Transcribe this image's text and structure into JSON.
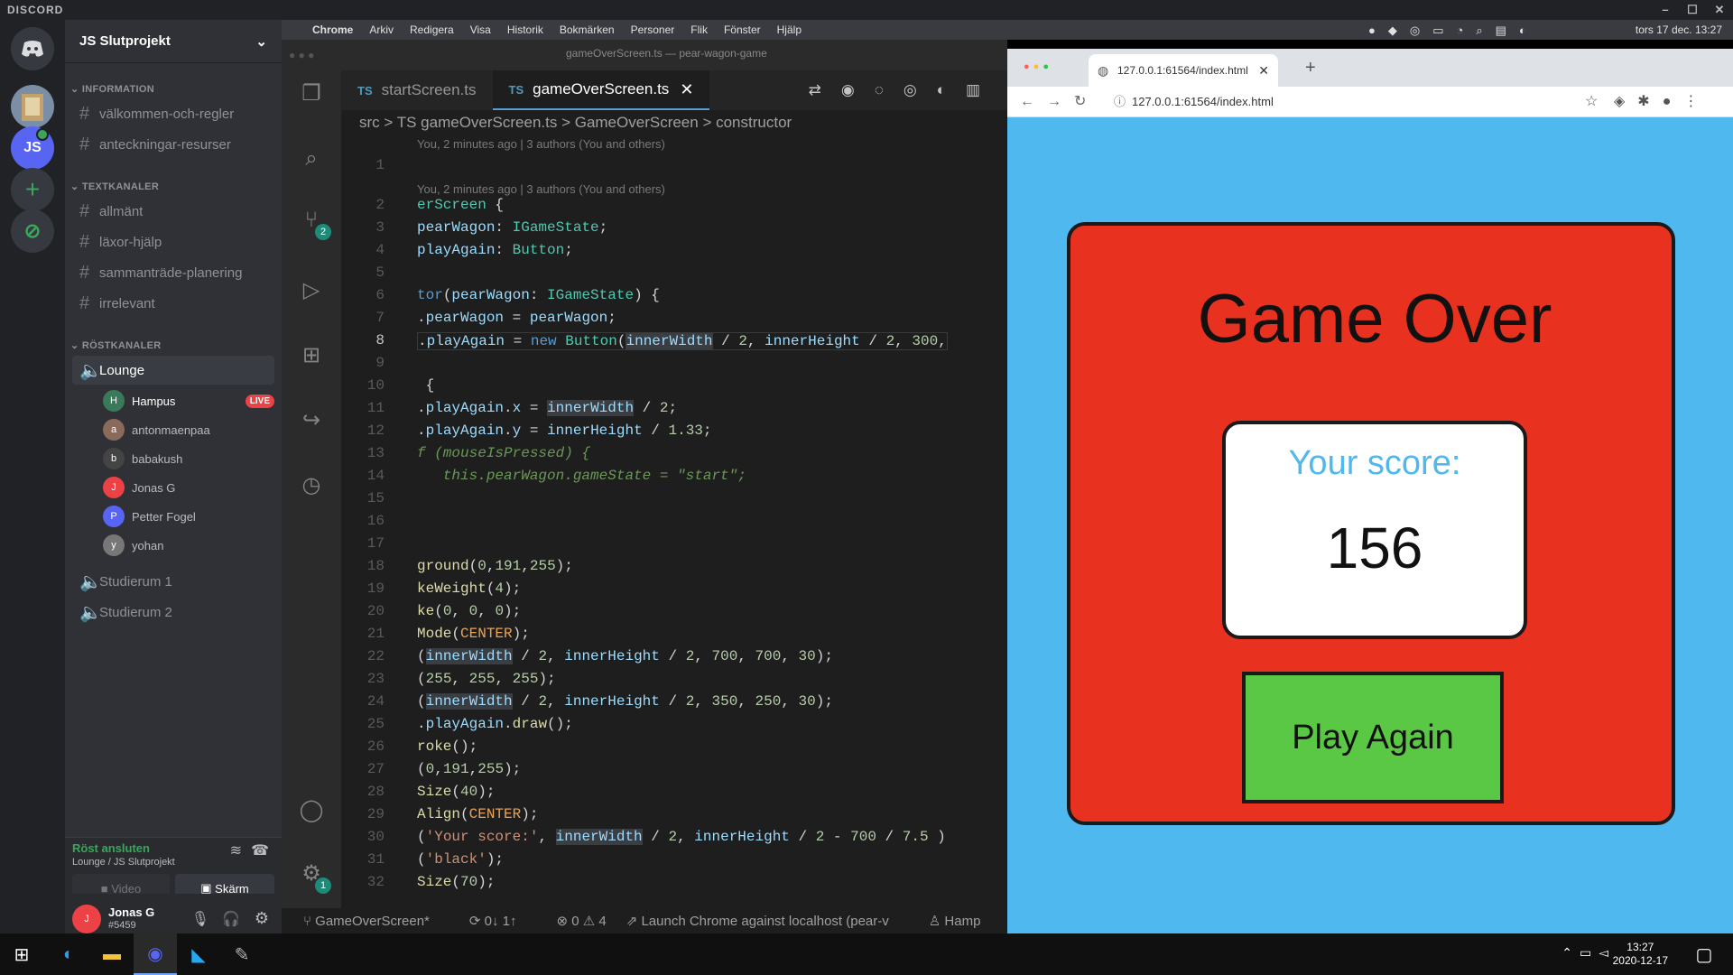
{
  "discord": {
    "window_title": "DISCORD",
    "server_name": "JS Slutprojekt",
    "guild_letters": "JS",
    "categories": [
      "INFORMATION",
      "TEXTKANALER",
      "RÖSTKANALER"
    ],
    "info_channels": [
      "välkommen-och-regler",
      "anteckningar-resurser"
    ],
    "text_channels": [
      "allmänt",
      "läxor-hjälp",
      "sammanträde-planering",
      "irrelevant"
    ],
    "voice_channels": [
      "Lounge",
      "Studierum 1",
      "Studierum 2"
    ],
    "lounge_users": [
      "Hampus",
      "antonmaenpaa",
      "babakush",
      "Jonas G",
      "Petter Fogel",
      "yohan"
    ],
    "live_badge": "LIVE",
    "voice_status": "Röst ansluten",
    "voice_location": "Lounge / JS Slutprojekt",
    "video_label": "Video",
    "screen_label": "Skärm",
    "username": "Jonas G",
    "tag": "#5459"
  },
  "mac_menu": {
    "items": [
      "Chrome",
      "Arkiv",
      "Redigera",
      "Visa",
      "Historik",
      "Bokmärken",
      "Personer",
      "Flik",
      "Fönster",
      "Hjälp"
    ],
    "clock": "tors 17 dec. 13:27",
    "window_title": "gameOverScreen.ts — pear-wagon-game"
  },
  "vscode": {
    "tabs": [
      "startScreen.ts",
      "gameOverScreen.ts"
    ],
    "tab_lang": "TS",
    "breadcrumb": "src > TS gameOverScreen.ts > GameOverScreen > constructor",
    "blame": "You, 2 minutes ago | 3 authors (You and others)",
    "source_control_badge": "2",
    "settings_badge": "1",
    "status_items": [
      "GameOverScreen*",
      "0↓ 1↑",
      "⊗ 0 ⚠ 4",
      "Launch Chrome against localhost (pear-v",
      "Hamp"
    ],
    "line_numbers": [
      "1",
      "2",
      "3",
      "4",
      "5",
      "6",
      "7",
      "8",
      "9",
      "10",
      "11",
      "12",
      "13",
      "14",
      "15",
      "16",
      "17",
      "18",
      "19",
      "20",
      "21",
      "22",
      "23",
      "24",
      "25",
      "26",
      "27",
      "28",
      "29",
      "30",
      "31",
      "32"
    ]
  },
  "chrome": {
    "tab_title": "127.0.0.1:61564/index.html",
    "url": "127.0.0.1:61564/index.html"
  },
  "game": {
    "title": "Game Over",
    "score_label": "Your score:",
    "score": "156",
    "button": "Play Again"
  },
  "taskbar": {
    "time": "13:27",
    "date": "2020-12-17"
  },
  "colors": {
    "discord_bg": "#2f3136",
    "game_red": "#e8321f",
    "game_blue": "#4fb8ef",
    "game_green": "#5bc845",
    "live_red": "#ed4245"
  }
}
